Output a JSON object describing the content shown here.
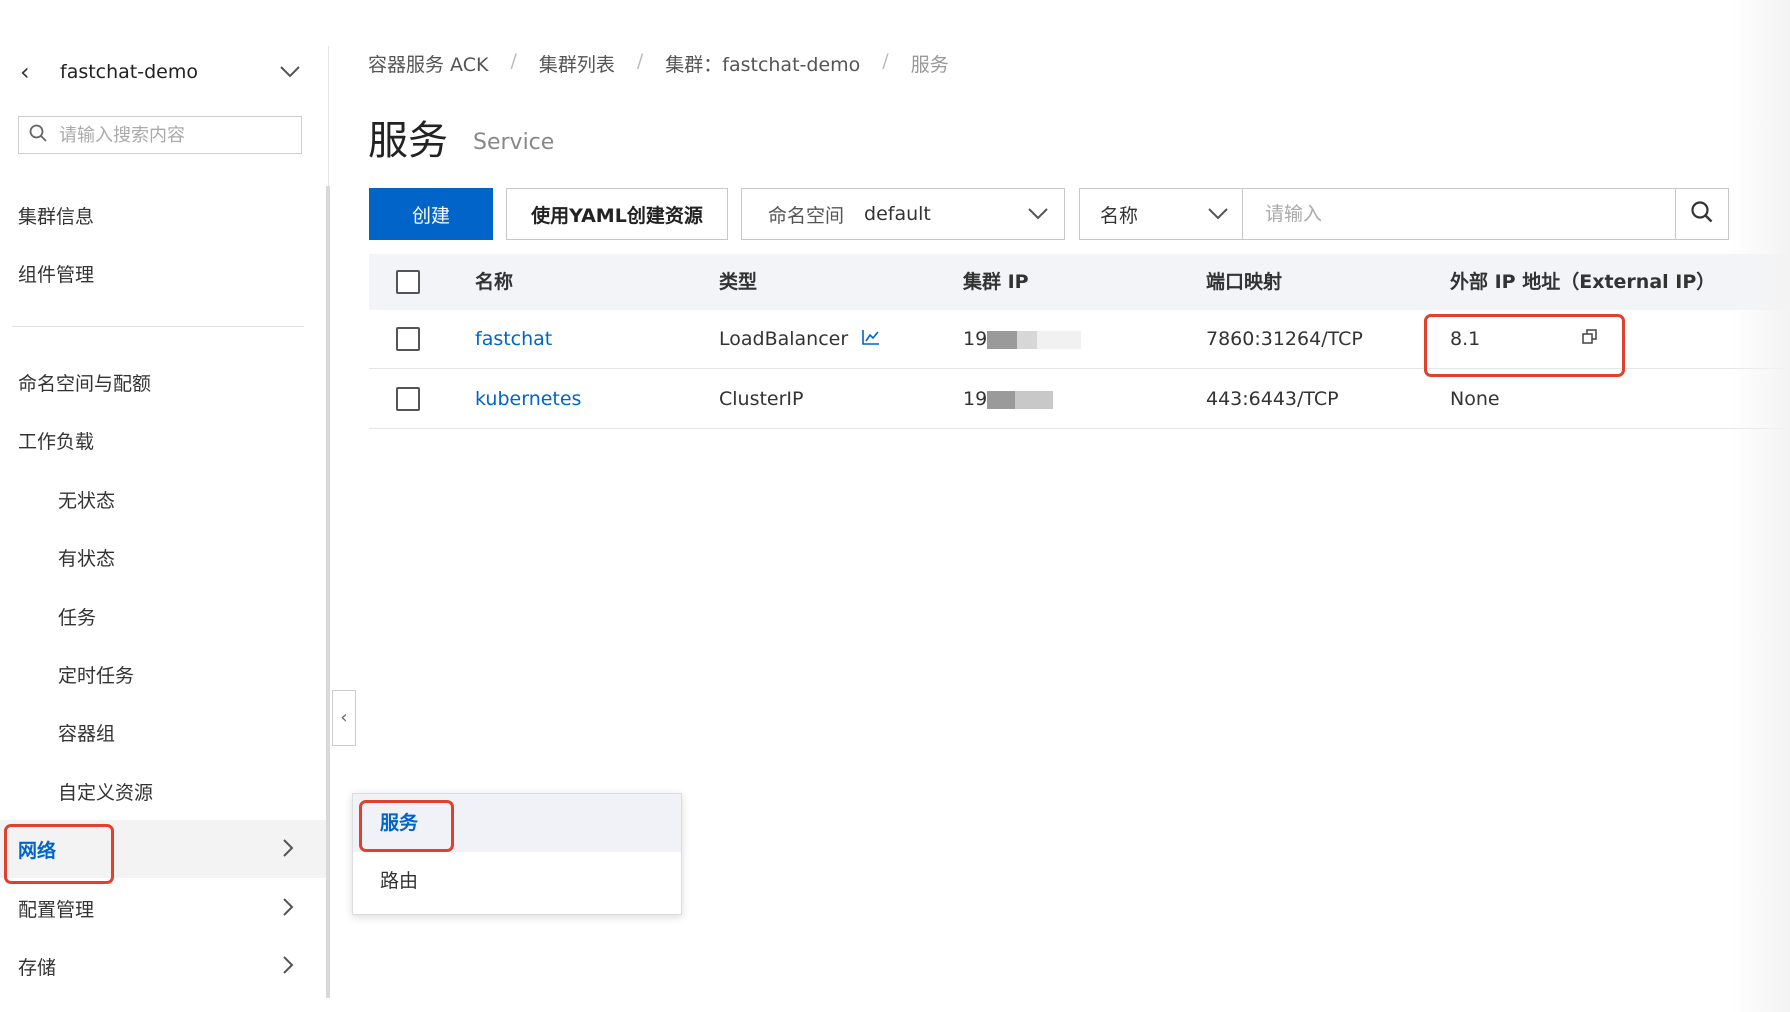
{
  "sidebar": {
    "cluster_name": "fastchat-demo",
    "search_placeholder": "请输入搜索内容",
    "items": [
      {
        "label": "集群信息"
      },
      {
        "label": "组件管理"
      },
      {
        "label": "命名空间与配额"
      },
      {
        "label": "工作负载"
      },
      {
        "label": "无状态"
      },
      {
        "label": "有状态"
      },
      {
        "label": "任务"
      },
      {
        "label": "定时任务"
      },
      {
        "label": "容器组"
      },
      {
        "label": "自定义资源"
      },
      {
        "label": "网络"
      },
      {
        "label": "配置管理"
      },
      {
        "label": "存储"
      }
    ]
  },
  "popup_menu": {
    "items": [
      {
        "label": "服务"
      },
      {
        "label": "路由"
      }
    ]
  },
  "breadcrumb": {
    "items": [
      "容器服务 ACK",
      "集群列表",
      "集群：fastchat-demo",
      "服务"
    ],
    "separator": "/"
  },
  "page": {
    "title": "服务",
    "subtitle": "Service"
  },
  "toolbar": {
    "create_label": "创建",
    "yaml_label": "使用YAML创建资源",
    "namespace_label": "命名空间",
    "namespace_value": "default",
    "filter_field": "名称",
    "filter_placeholder": "请输入"
  },
  "table": {
    "headers": [
      "名称",
      "类型",
      "集群 IP",
      "端口映射",
      "外部 IP 地址（External IP）"
    ],
    "rows": [
      {
        "name": "fastchat",
        "type": "LoadBalancer",
        "cluster_ip": "19",
        "ports": "7860:31264/TCP",
        "external_ip": "8.1"
      },
      {
        "name": "kubernetes",
        "type": "ClusterIP",
        "cluster_ip": "19",
        "ports": "443:6443/TCP",
        "external_ip": "None"
      }
    ]
  },
  "colors": {
    "primary": "#0064c8",
    "highlight_box": "#e0412c",
    "header_bg": "#f2f4f8"
  }
}
